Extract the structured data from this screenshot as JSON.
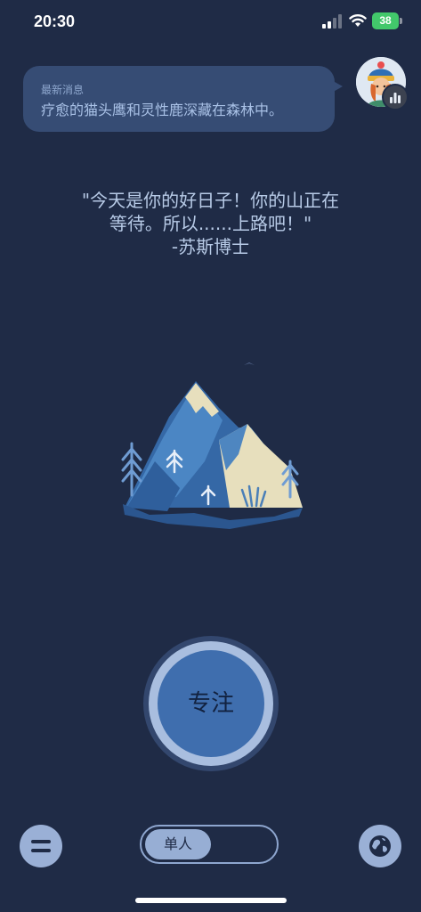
{
  "status_bar": {
    "time": "20:30",
    "battery": "38",
    "icons": [
      "signal-icon",
      "wifi-icon",
      "battery-icon"
    ]
  },
  "news": {
    "title": "最新消息",
    "body": "疗愈的猫头鹰和灵性鹿深藏在森林中。"
  },
  "avatar": {
    "badge_icon": "bar-chart-icon"
  },
  "quote": {
    "line1": "\"今天是你的好日子！你的山正在",
    "line2": "等待。所以......上路吧！\"",
    "line3": "-苏斯博士"
  },
  "focus": {
    "label": "专注"
  },
  "bottom": {
    "menu_icon": "menu-icon",
    "mode_selected": "单人",
    "globe_icon": "globe-icon"
  },
  "colors": {
    "background": "#1f2b46",
    "accent": "#3f6eae",
    "pill": "#97aed4",
    "battery": "#42c86b"
  }
}
